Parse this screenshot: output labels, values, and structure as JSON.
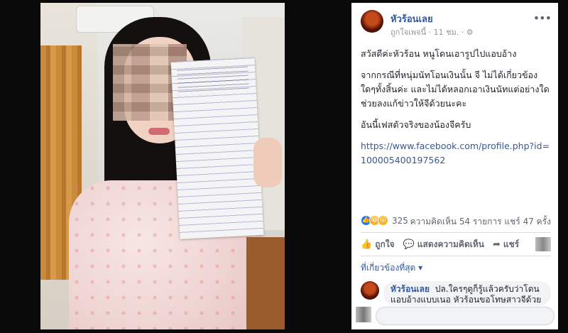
{
  "post": {
    "page_name": "หัวร้อนเลย",
    "meta_text": "ถูกใจเพจนี้ · 11 ชม. · ⚙",
    "paragraphs": [
      "สวัสดีค่ะหัวร้อน หนูโดนเอารูปไปแอบอ้าง",
      "จากกรณีที่หนุ่มนัทโอนเงินนั้น จี ไม่ได้เกี่ยวข้องใดๆทั้งสิ้นค่ะ และไม่ได้หลอกเอาเงินนัทแต่อย่างใด ช่วยลงแก้ข่าวให้จีด้วยนะคะ",
      "อันนี้เฟสตัวจริงของน้องจีครับ"
    ],
    "link": "https://www.facebook.com/profile.php?id=100005400197562"
  },
  "stats": {
    "reaction_count": "325",
    "comments_shares": "ความคิดเห็น 54 รายการ  แชร์ 47 ครั้ง"
  },
  "actions": {
    "like_label": "ถูกใจ",
    "comment_label": "แสดงความคิดเห็น",
    "share_label": "แชร์"
  },
  "filter": {
    "label": "ที่เกี่ยวข้องที่สุด ▾"
  },
  "comment": {
    "author": "หัวร้อนเลย",
    "text": "ปล.ใครๆดูก็รู้แล้วครับว่าโดนแอบอ้างแบบเนอ หัวร้อนขอโทษสาวจีด้วย"
  }
}
